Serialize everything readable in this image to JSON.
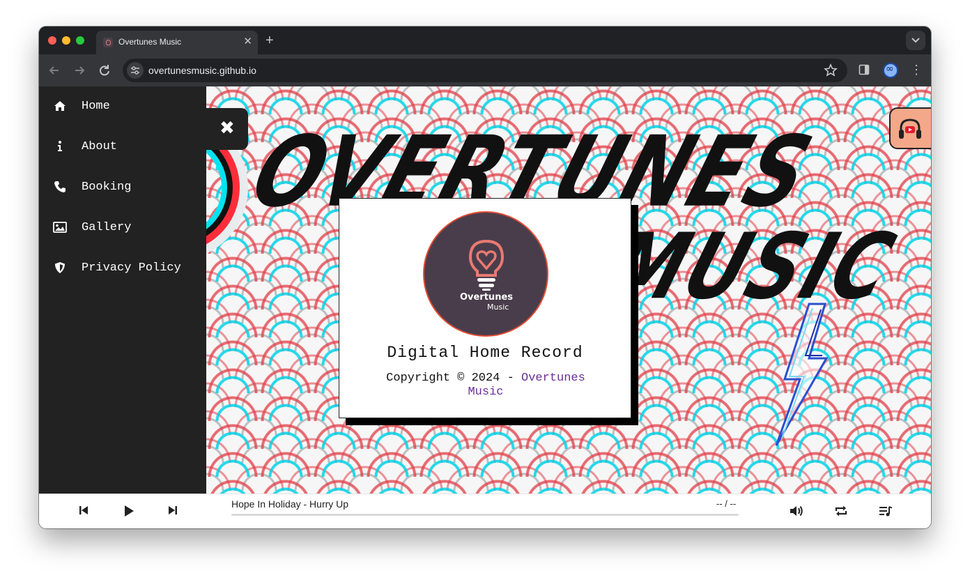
{
  "browser": {
    "tab_title": "Overtunes Music",
    "tab_close": "✕",
    "new_tab": "+",
    "url": "overtunesmusic.github.io",
    "menu": "⋮"
  },
  "sidebar": {
    "items": [
      {
        "label": "Home",
        "icon": "home-icon"
      },
      {
        "label": "About",
        "icon": "info-icon"
      },
      {
        "label": "Booking",
        "icon": "phone-icon"
      },
      {
        "label": "Gallery",
        "icon": "image-icon"
      },
      {
        "label": "Privacy Policy",
        "icon": "shield-icon"
      }
    ]
  },
  "hero": {
    "logo_line1": "OVERTUNES",
    "logo_line2": "MUSIC",
    "close_symbol": "✖"
  },
  "card": {
    "brand": "Overtunes",
    "brand_sub": "Music",
    "title": "Digital Home Record",
    "copyright": "Copyright © 2024 - ",
    "copyright_link": "Overtunes Music"
  },
  "player": {
    "track": "Hope In Holiday - Hurry Up",
    "time": "-- / --",
    "progress": 0
  },
  "colors": {
    "sidebar_bg": "#222222",
    "card_link": "#6a2f96",
    "avatar_bg": "#4a3d4b",
    "avatar_accent": "#e87a72",
    "youtube_button": "#f4a88a"
  }
}
